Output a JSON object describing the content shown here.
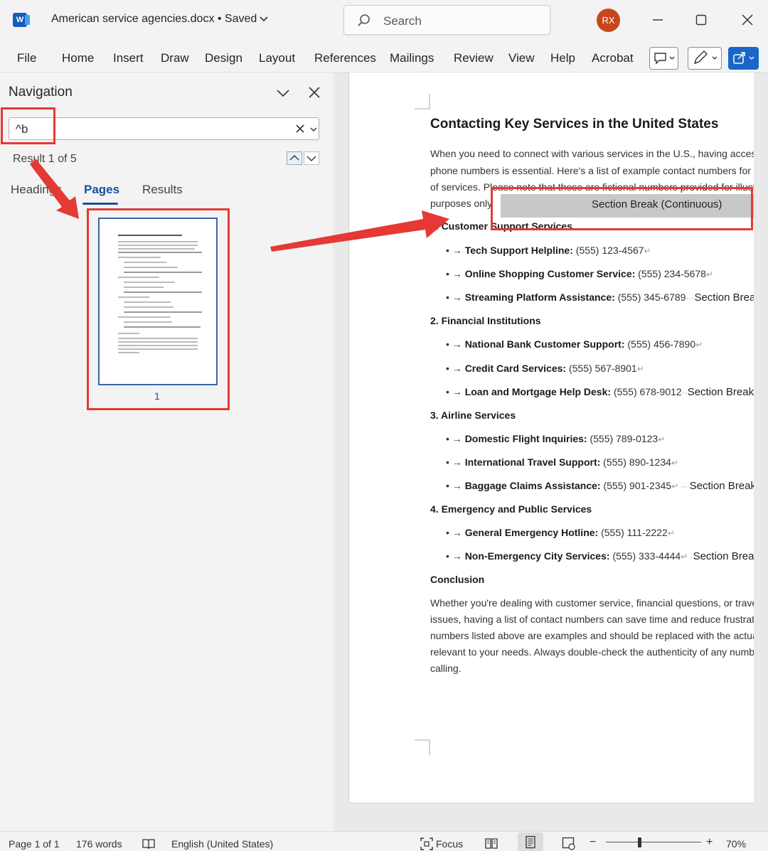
{
  "titlebar": {
    "app_logo": "W",
    "doc_title": "American service agencies.docx • Saved",
    "search_placeholder": "Search",
    "avatar_initials": "RX"
  },
  "ribbon": {
    "tabs": [
      "File",
      "Home",
      "Insert",
      "Draw",
      "Design",
      "Layout",
      "References",
      "Mailings",
      "Review",
      "View",
      "Help",
      "Acrobat"
    ]
  },
  "nav": {
    "title": "Navigation",
    "search_value": "^b",
    "result_text": "Result 1 of 5",
    "tabs": [
      "Headings",
      "Pages",
      "Results"
    ],
    "active_tab": "Pages",
    "page_number": "1"
  },
  "document": {
    "title": "Contacting Key Services in the United States",
    "intro": [
      "When you need to connect with various services in the U.S., having access to",
      "phone numbers is essential. Here's a list of example contact numbers for diff",
      "of services. Please note that these are fictional numbers provided for illustrat",
      "purposes only"
    ],
    "section_break_label": "Section Break (Continuous)",
    "section_break_short": "Section Break (Co",
    "sections": [
      {
        "heading": "1. Customer Support Services",
        "items": [
          {
            "label": "Tech Support Helpline:",
            "value": "(555) 123-4567"
          },
          {
            "label": "Online Shopping Customer Service:",
            "value": "(555) 234-5678"
          },
          {
            "label": "Streaming Platform Assistance:",
            "value": "(555) 345-6789"
          }
        ]
      },
      {
        "heading": "2. Financial Institutions",
        "items": [
          {
            "label": "National Bank Customer Support:",
            "value": "(555) 456-7890"
          },
          {
            "label": "Credit Card Services:",
            "value": "(555) 567-8901"
          },
          {
            "label": "Loan and Mortgage Help Desk:",
            "value": "(555) 678-9012"
          }
        ]
      },
      {
        "heading": "3. Airline Services",
        "items": [
          {
            "label": "Domestic Flight Inquiries:",
            "value": "(555) 789-0123"
          },
          {
            "label": "International Travel Support:",
            "value": "(555) 890-1234"
          },
          {
            "label": "Baggage Claims Assistance:",
            "value": "(555) 901-2345"
          }
        ]
      },
      {
        "heading": "4. Emergency and Public Services",
        "items": [
          {
            "label": "General Emergency Hotline:",
            "value": "(555) 111-2222"
          },
          {
            "label": "Non-Emergency City Services:",
            "value": "(555) 333-4444"
          }
        ]
      }
    ],
    "conclusion_heading": "Conclusion",
    "conclusion": [
      "Whether you're dealing with customer service, financial questions, or travel-r",
      "issues, having a list of contact numbers can save time and reduce frustration",
      "numbers listed above are examples and should be replaced with the actual c",
      "relevant to your needs. Always double-check the authenticity of any number",
      "calling."
    ]
  },
  "status": {
    "page": "Page 1 of 1",
    "words": "176 words",
    "language": "English (United States)",
    "focus": "Focus",
    "zoom": "70%"
  },
  "colors": {
    "accent": "#1b4f9c",
    "annotation": "#e53935",
    "section_break_bg": "#c8c8c8"
  }
}
